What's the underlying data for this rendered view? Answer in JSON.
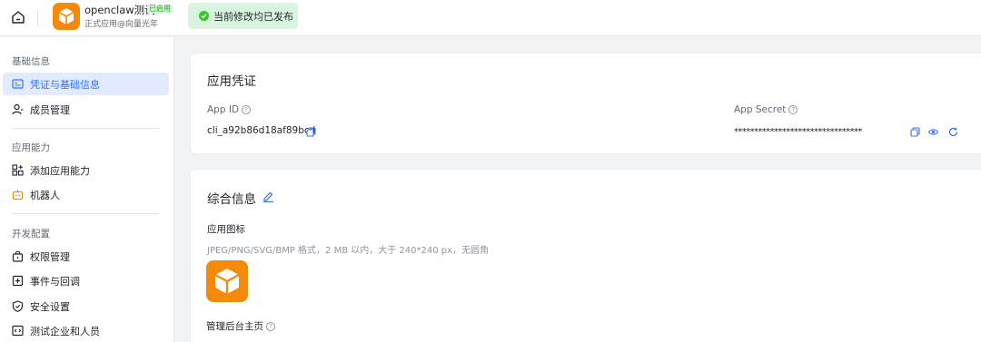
{
  "header": {
    "app_name": "openclaw测试",
    "app_badge": "已启用",
    "app_sub": "正式应用@向量光年",
    "status_text": "当前修改均已发布"
  },
  "sidebar": {
    "groups": [
      {
        "title": "基础信息",
        "items": [
          {
            "label": "凭证与基础信息",
            "icon": "credential-icon"
          },
          {
            "label": "成员管理",
            "icon": "member-icon"
          }
        ]
      },
      {
        "title": "应用能力",
        "items": [
          {
            "label": "添加应用能力",
            "icon": "apps-add-icon"
          },
          {
            "label": "机器人",
            "icon": "robot-icon"
          }
        ]
      },
      {
        "title": "开发配置",
        "items": [
          {
            "label": "权限管理",
            "icon": "lock-icon"
          },
          {
            "label": "事件与回调",
            "icon": "event-icon"
          },
          {
            "label": "安全设置",
            "icon": "shield-icon"
          },
          {
            "label": "测试企业和人员",
            "icon": "code-icon"
          }
        ]
      }
    ]
  },
  "credentials": {
    "title": "应用凭证",
    "app_id_label": "App ID",
    "app_id_value": "cli_a92b86d18af89bcd",
    "app_secret_label": "App Secret",
    "app_secret_value": "********************************"
  },
  "general": {
    "title": "综合信息",
    "icon_label": "应用图标",
    "icon_hint": "JPEG/PNG/SVG/BMP 格式，2 MB 以内，大于 240*240 px，无圆角",
    "admin_home_label": "管理后台主页"
  },
  "colors": {
    "accent": "#3370ff",
    "brand_orange": "#f5890a",
    "success": "#34c724"
  }
}
